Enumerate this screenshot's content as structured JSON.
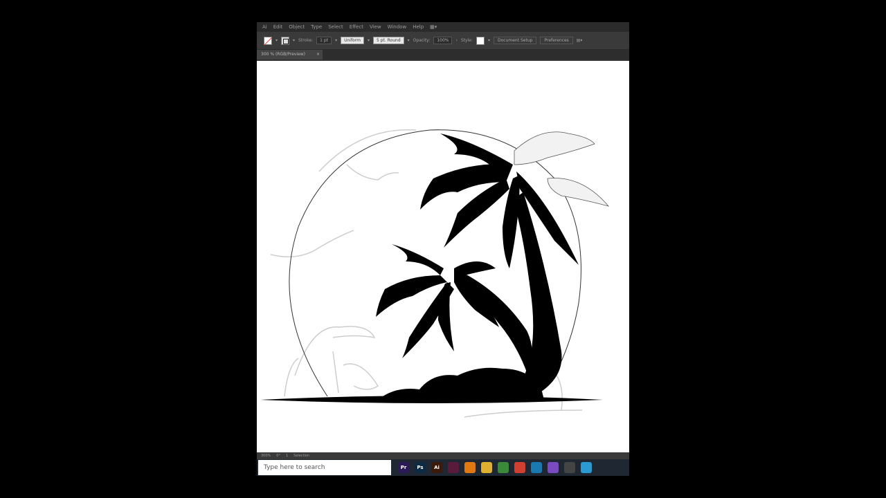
{
  "menu": [
    "Ai",
    "Edit",
    "Object",
    "Type",
    "Select",
    "Effect",
    "View",
    "Window",
    "Help"
  ],
  "control": {
    "stroke_label": "Stroke:",
    "stroke_value": "1 pt",
    "profile": "Uniform",
    "brush": "5 pt. Round",
    "opacity_label": "Opacity:",
    "opacity_value": "100%",
    "style_label": "Style:",
    "document_setup": "Document Setup",
    "preferences": "Preferences"
  },
  "tab": {
    "label": "300 % (RGB/Preview)",
    "close": "×"
  },
  "status": {
    "zoom": "300%",
    "rotation": "0°",
    "artboard": "1",
    "tool": "Selection"
  },
  "taskbar": {
    "search_placeholder": "Type here to search",
    "apps": [
      {
        "name": "premiere-pro-icon",
        "label": "Pr",
        "color": "#2a1a55"
      },
      {
        "name": "photoshop-icon",
        "label": "Ps",
        "color": "#0d2a44"
      },
      {
        "name": "illustrator-icon",
        "label": "Ai",
        "color": "#3a1a0a"
      },
      {
        "name": "app-circle-icon",
        "label": "",
        "color": "#5a1a3a"
      },
      {
        "name": "vlc-icon",
        "label": "",
        "color": "#e07a10"
      },
      {
        "name": "file-explorer-icon",
        "label": "",
        "color": "#e0b030"
      },
      {
        "name": "xbox-icon",
        "label": "",
        "color": "#3a8a3a"
      },
      {
        "name": "chrome-icon",
        "label": "",
        "color": "#d04030"
      },
      {
        "name": "edge-icon",
        "label": "",
        "color": "#1a7ab0"
      },
      {
        "name": "viber-icon",
        "label": "",
        "color": "#7a4ac0"
      },
      {
        "name": "camera-icon",
        "label": "",
        "color": "#444"
      },
      {
        "name": "network-icon",
        "label": "",
        "color": "#2a9ad0"
      }
    ]
  },
  "colors": {
    "accent": "#ff9a00",
    "taskbar": "#1f2733"
  }
}
